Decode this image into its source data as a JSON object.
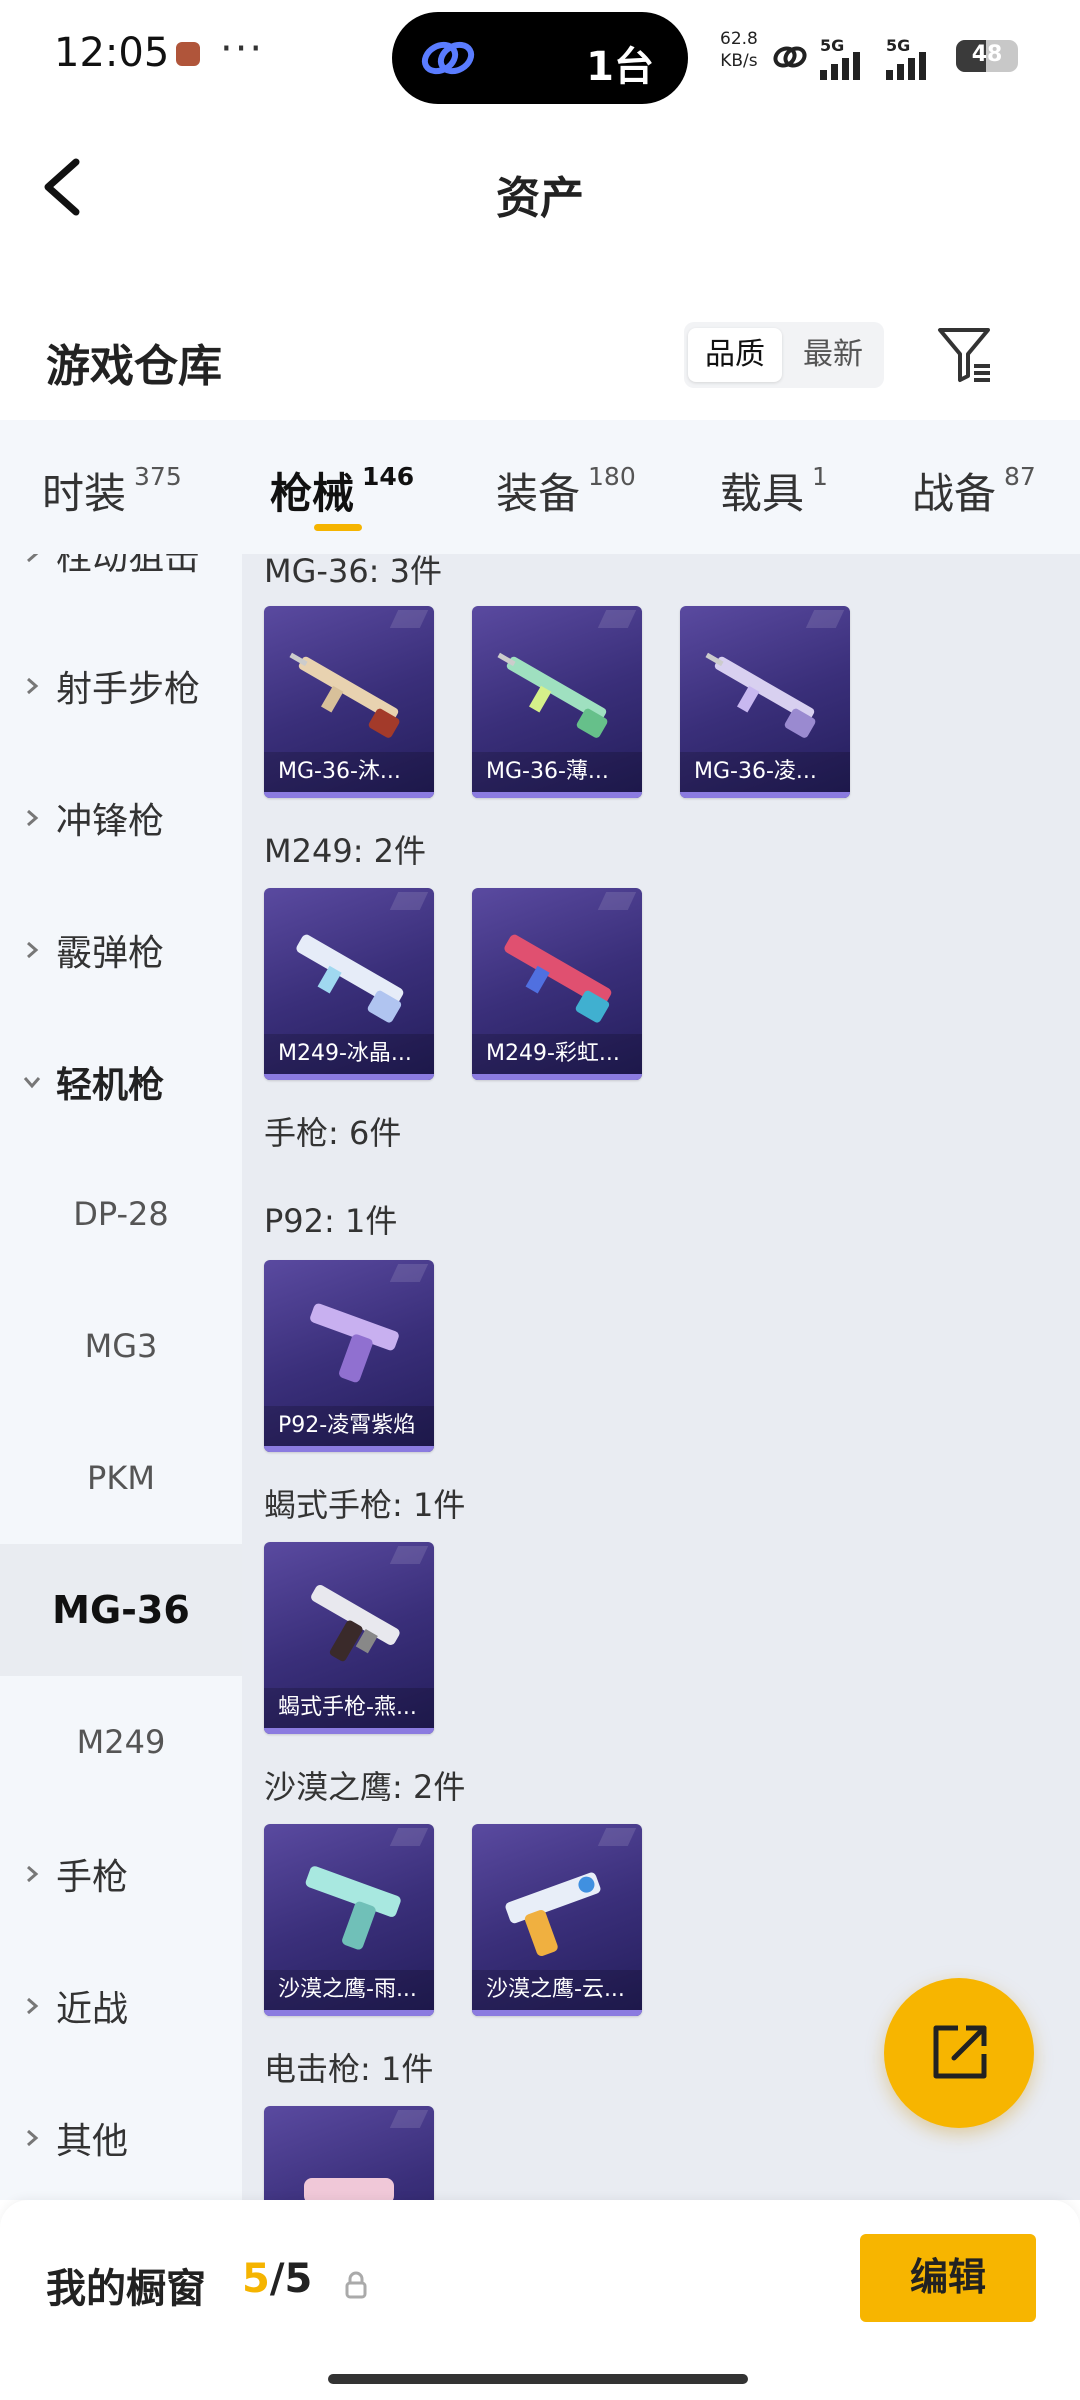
{
  "status_bar": {
    "time": "12:05",
    "island_text": "1台",
    "net_speed_value": "62.8",
    "net_speed_unit": "KB/s",
    "sim1": "5G",
    "sim2": "5G",
    "battery": "48",
    "battery_level": 48
  },
  "header": {
    "title": "资产"
  },
  "section": {
    "title": "游戏仓库",
    "sort_options": [
      "品质",
      "最新"
    ],
    "sort_selected": "品质"
  },
  "tabs": [
    {
      "label": "时装",
      "count": "375"
    },
    {
      "label": "枪械",
      "count": "146",
      "active": true
    },
    {
      "label": "装备",
      "count": "180"
    },
    {
      "label": "载具",
      "count": "1"
    },
    {
      "label": "战备",
      "count": "87"
    }
  ],
  "sidebar": {
    "partial_top": "栓动狙击",
    "items": [
      {
        "label": "射手步枪"
      },
      {
        "label": "冲锋枪"
      },
      {
        "label": "霰弹枪"
      },
      {
        "label": "轻机枪",
        "expanded": true
      }
    ],
    "sub_items": [
      "DP-28",
      "MG3",
      "PKM",
      "MG-36",
      "M249"
    ],
    "sub_selected": "MG-36",
    "items_after": [
      {
        "label": "手枪"
      },
      {
        "label": "近战"
      },
      {
        "label": "其他"
      }
    ]
  },
  "content": {
    "groups": [
      {
        "title": "MG-36: 3件",
        "cards": [
          "MG-36-沐...",
          "MG-36-薄...",
          "MG-36-凌..."
        ]
      },
      {
        "title": "M249: 2件",
        "cards": [
          "M249-冰晶...",
          "M249-彩虹..."
        ]
      },
      {
        "title": "手枪: 6件",
        "cards": []
      },
      {
        "title": "P92: 1件",
        "cards": [
          "P92-凌霄紫焰"
        ]
      },
      {
        "title": "蝎式手枪: 1件",
        "cards": [
          "蝎式手枪-燕..."
        ]
      },
      {
        "title": "沙漠之鹰: 2件",
        "cards": [
          "沙漠之鹰-雨...",
          "沙漠之鹰-云..."
        ]
      },
      {
        "title": "电击枪: 1件",
        "cards": [
          ""
        ]
      }
    ]
  },
  "bottom": {
    "label": "我的橱窗",
    "count_current": "5",
    "count_separator": "/",
    "count_total": "5",
    "edit_label": "编辑"
  },
  "colors": {
    "accent": "#f7b500",
    "card_bg": "#3a2f7a",
    "tab_bg": "#f4f7fb",
    "content_bg": "#e9ecf2"
  }
}
